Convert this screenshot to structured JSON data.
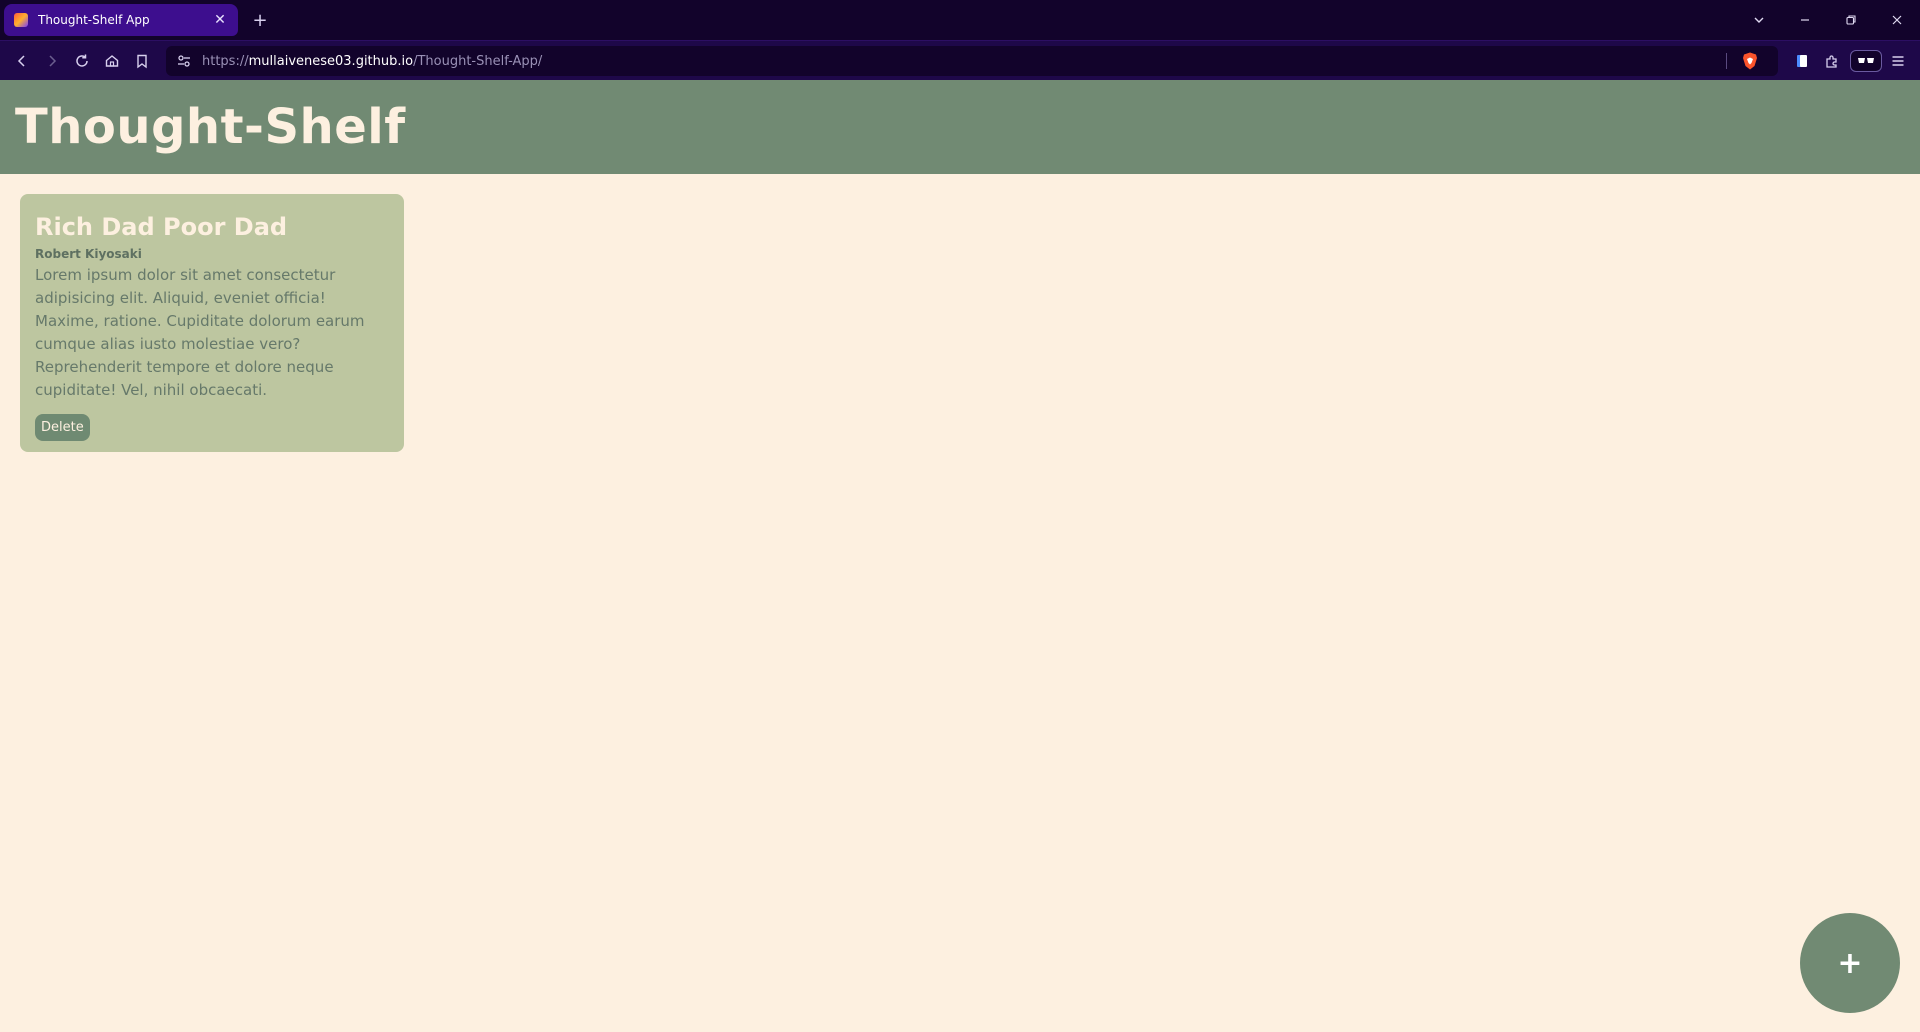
{
  "browser": {
    "tab": {
      "title": "Thought-Shelf App"
    },
    "url": {
      "scheme": "https://",
      "host": "mullaivenese03.github.io",
      "path": "/Thought-Shelf-App/"
    }
  },
  "app": {
    "title": "Thought-Shelf",
    "add_label": "+"
  },
  "cards": [
    {
      "title": "Rich Dad Poor Dad",
      "author": "Robert Kiyosaki",
      "body": "Lorem ipsum dolor sit amet consectetur adipisicing elit. Aliquid, eveniet officia! Maxime, ratione. Cupiditate dolorum earum cumque alias iusto molestiae vero? Reprehenderit tempore et dolore neque cupiditate! Vel, nihil obcaecati.",
      "delete_label": "Delete"
    }
  ],
  "colors": {
    "header_bg": "#718a73",
    "page_bg": "#fdf0e0",
    "card_bg": "#bdc6a0",
    "browser_chrome": "#1e0849"
  }
}
